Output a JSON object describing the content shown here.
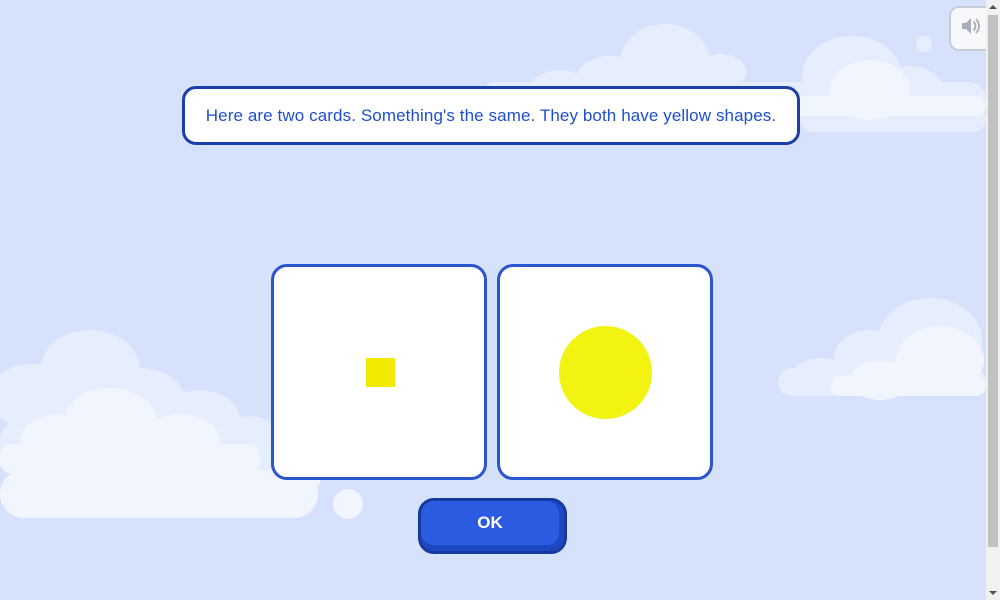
{
  "instruction": {
    "text": "Here are two cards. Something's the same. They both have yellow shapes."
  },
  "cards": [
    {
      "shape": "square",
      "color": "#f2ea00"
    },
    {
      "shape": "circle",
      "color": "#f3f312"
    }
  ],
  "ok_button": {
    "label": "OK"
  },
  "sound_button": {
    "icon": "speaker-icon"
  },
  "colors": {
    "background": "#d6e2fb",
    "accent_blue": "#2b5be0",
    "border_blue": "#1a3fa8",
    "text_blue": "#1f4fcf"
  }
}
